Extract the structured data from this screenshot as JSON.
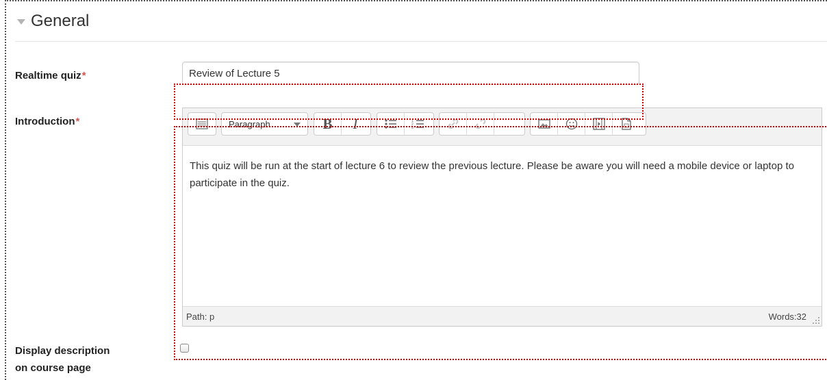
{
  "section": {
    "legend": "General"
  },
  "fields": {
    "name_label": "Realtime quiz",
    "name_value": "Review of Lecture 5",
    "intro_label": "Introduction",
    "required_marker": "*",
    "display_desc_label_line1": "Display description",
    "display_desc_label_line2": "on course page",
    "display_desc_checked": false
  },
  "editor": {
    "format_select": "Paragraph",
    "content": "This quiz will be run at the start of lecture 6 to review the previous lecture. Please be aware you will need a mobile device or laptop to participate in the quiz.",
    "status_path": "Path: p",
    "status_words": "Words:32",
    "toolbar_icons": [
      "toolbar-toggle-icon",
      "bold-icon",
      "italic-icon",
      "unordered-list-icon",
      "ordered-list-icon",
      "link-icon",
      "unlink-icon",
      "image-icon",
      "emoticon-icon",
      "media-icon",
      "file-icon"
    ]
  },
  "colors": {
    "required": "#d9534f",
    "annotation": "#cc0000"
  }
}
